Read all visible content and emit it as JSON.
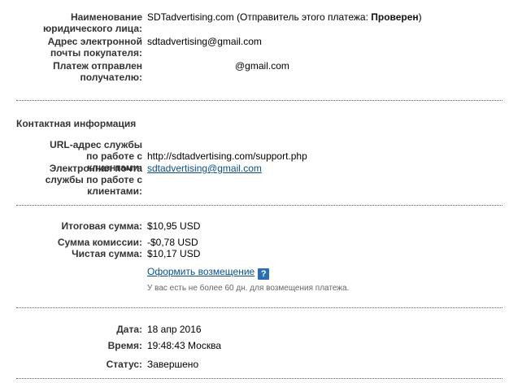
{
  "seller": {
    "legal_name_label": "Наименование юридического лица:",
    "legal_name_value": "SDTadvertising.com",
    "sender_status_prefix": "(Отправитель этого платежа: ",
    "sender_status_value": "Проверен",
    "sender_status_suffix": ")",
    "buyer_email_label": "Адрес электронной почты покупателя:",
    "buyer_email_value": "sdtadvertising@gmail.com",
    "payment_sent_label": "Платеж отправлен получателю:",
    "payment_sent_value": "@gmail.com"
  },
  "contact": {
    "section_title": "Контактная информация",
    "support_url_label": "URL-адрес службы по работе с клиентами:",
    "support_url_value": "http://sdtadvertising.com/support.php",
    "support_email_label": "Электронная почта службы по работе с клиентами:",
    "support_email_value": "sdtadvertising@gmail.com"
  },
  "amounts": {
    "total_label": "Итоговая сумма:",
    "total_value": "$10,95 USD",
    "fee_label": "Сумма комиссии:",
    "fee_value": "-$0,78 USD",
    "net_label": "Чистая сумма:",
    "net_value": "$10,17 USD",
    "refund_link": "Оформить возмещение",
    "help_icon_glyph": "?",
    "refund_note": "У вас есть не более 60 дн. для возмещения платежа."
  },
  "details": {
    "date_label": "Дата:",
    "date_value": "18 апр 2016",
    "time_label": "Время:",
    "time_value": "19:48:43 Москва",
    "status_label": "Статус:",
    "status_value": "Завершено"
  }
}
